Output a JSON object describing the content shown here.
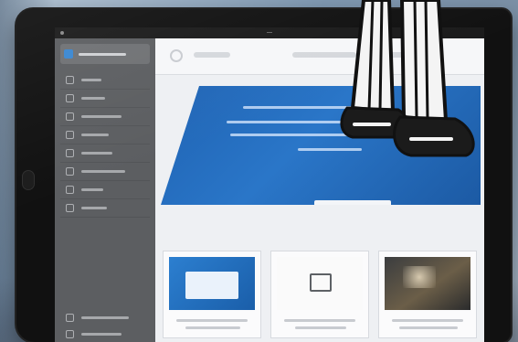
{
  "scene": {
    "description_colors": {
      "background": "#8aa1b8",
      "tablet_body": "#111111",
      "sidebar": "#5c5e61",
      "hero": "#2a76c8",
      "accent": "#3a87d1"
    }
  },
  "device": {
    "status_bar_title": "—"
  },
  "sidebar": {
    "items": [
      {
        "icon": "user-icon"
      },
      {
        "icon": "list-icon"
      },
      {
        "icon": "grid-icon"
      },
      {
        "icon": "chat-icon"
      },
      {
        "icon": "bell-icon"
      },
      {
        "icon": "chart-icon"
      },
      {
        "icon": "folder-icon"
      },
      {
        "icon": "gear-icon"
      }
    ],
    "footer_items": [
      {
        "icon": "help-icon"
      },
      {
        "icon": "logout-icon"
      }
    ]
  },
  "main": {
    "cards": [
      {
        "image": "blue-screens-image"
      },
      {
        "image": "monitor-icon-image"
      },
      {
        "image": "dark-photo-image"
      }
    ]
  }
}
